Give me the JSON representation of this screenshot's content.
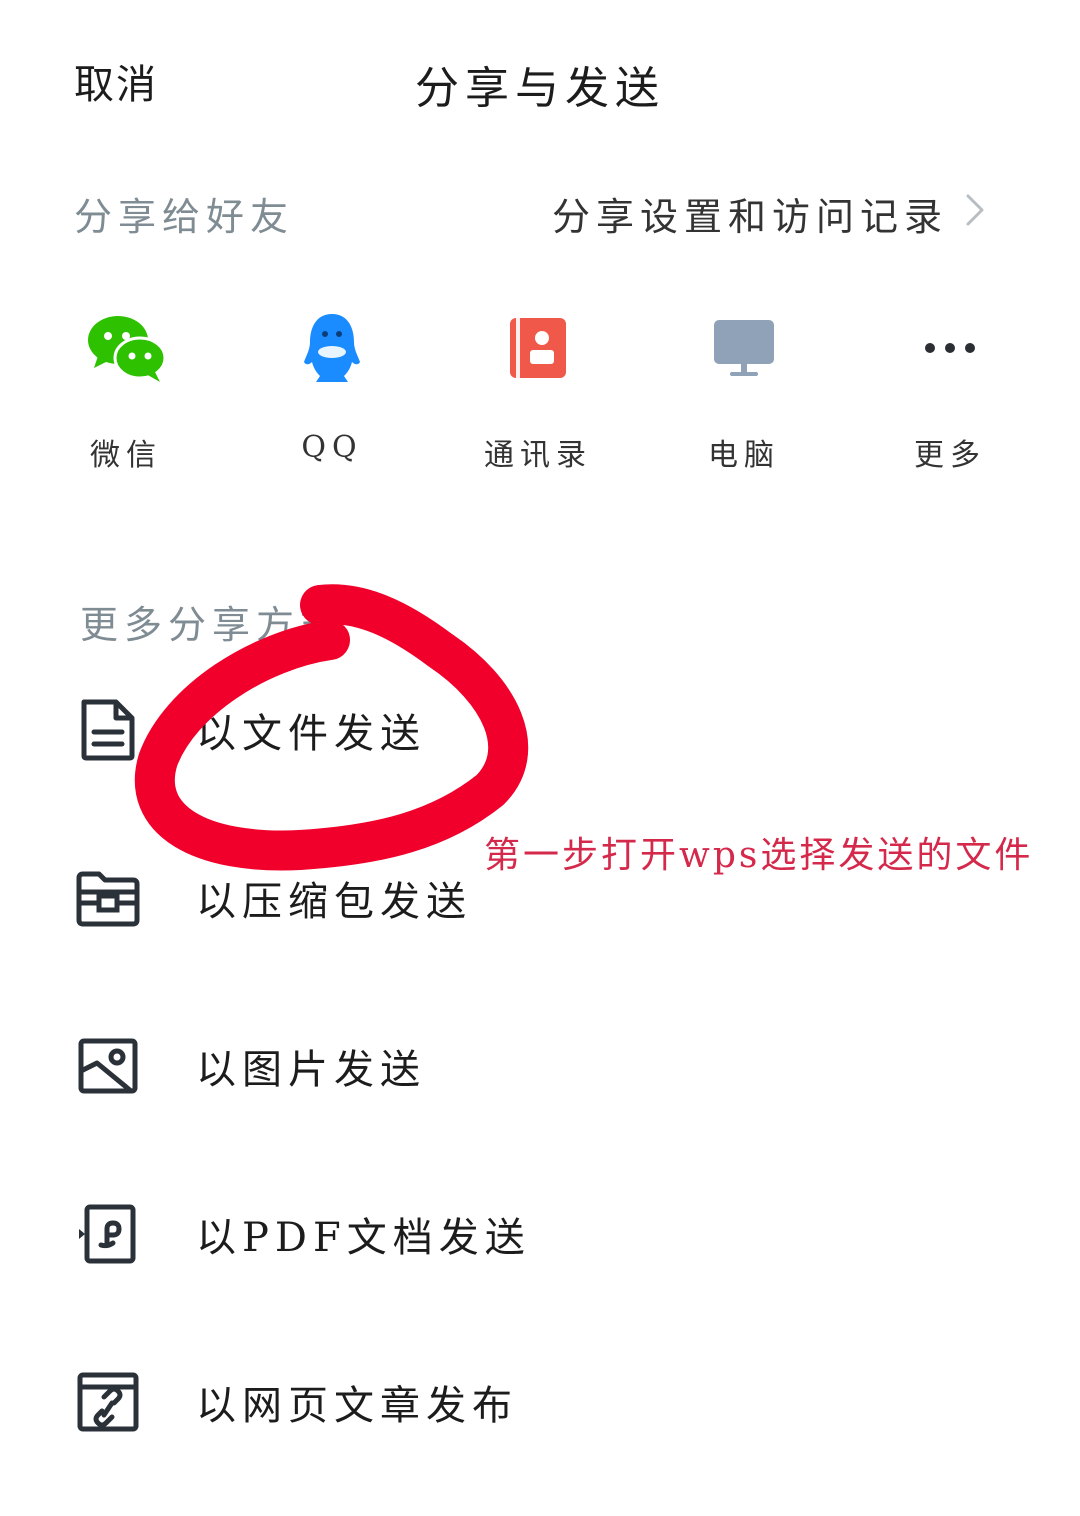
{
  "header": {
    "cancel_label": "取消",
    "title": "分享与发送"
  },
  "friends": {
    "section_label": "分享给好友",
    "settings_label": "分享设置和访问记录",
    "apps": [
      {
        "label": "微信",
        "icon": "wechat-icon",
        "color": "#2dc100"
      },
      {
        "label": "QQ",
        "icon": "qq-icon",
        "color": "#1a8cff"
      },
      {
        "label": "通讯录",
        "icon": "contacts-icon",
        "color": "#f0584a"
      },
      {
        "label": "电脑",
        "icon": "computer-icon",
        "color": "#8fa2b8"
      },
      {
        "label": "更多",
        "icon": "more-icon",
        "color": "#2b2f33"
      }
    ]
  },
  "more_section": {
    "section_label": "更多分享方式",
    "items": [
      {
        "label": "以文件发送",
        "icon": "file-icon"
      },
      {
        "label": "以压缩包发送",
        "icon": "zip-folder-icon"
      },
      {
        "label": "以图片发送",
        "icon": "image-icon"
      },
      {
        "label": "以PDF文档发送",
        "icon": "pdf-icon"
      },
      {
        "label": "以网页文章发布",
        "icon": "web-link-icon"
      }
    ]
  },
  "annotation": {
    "text": "第一步打开wps选择发送的文件",
    "color": "#d4294b",
    "mark_color": "#f0002a"
  }
}
